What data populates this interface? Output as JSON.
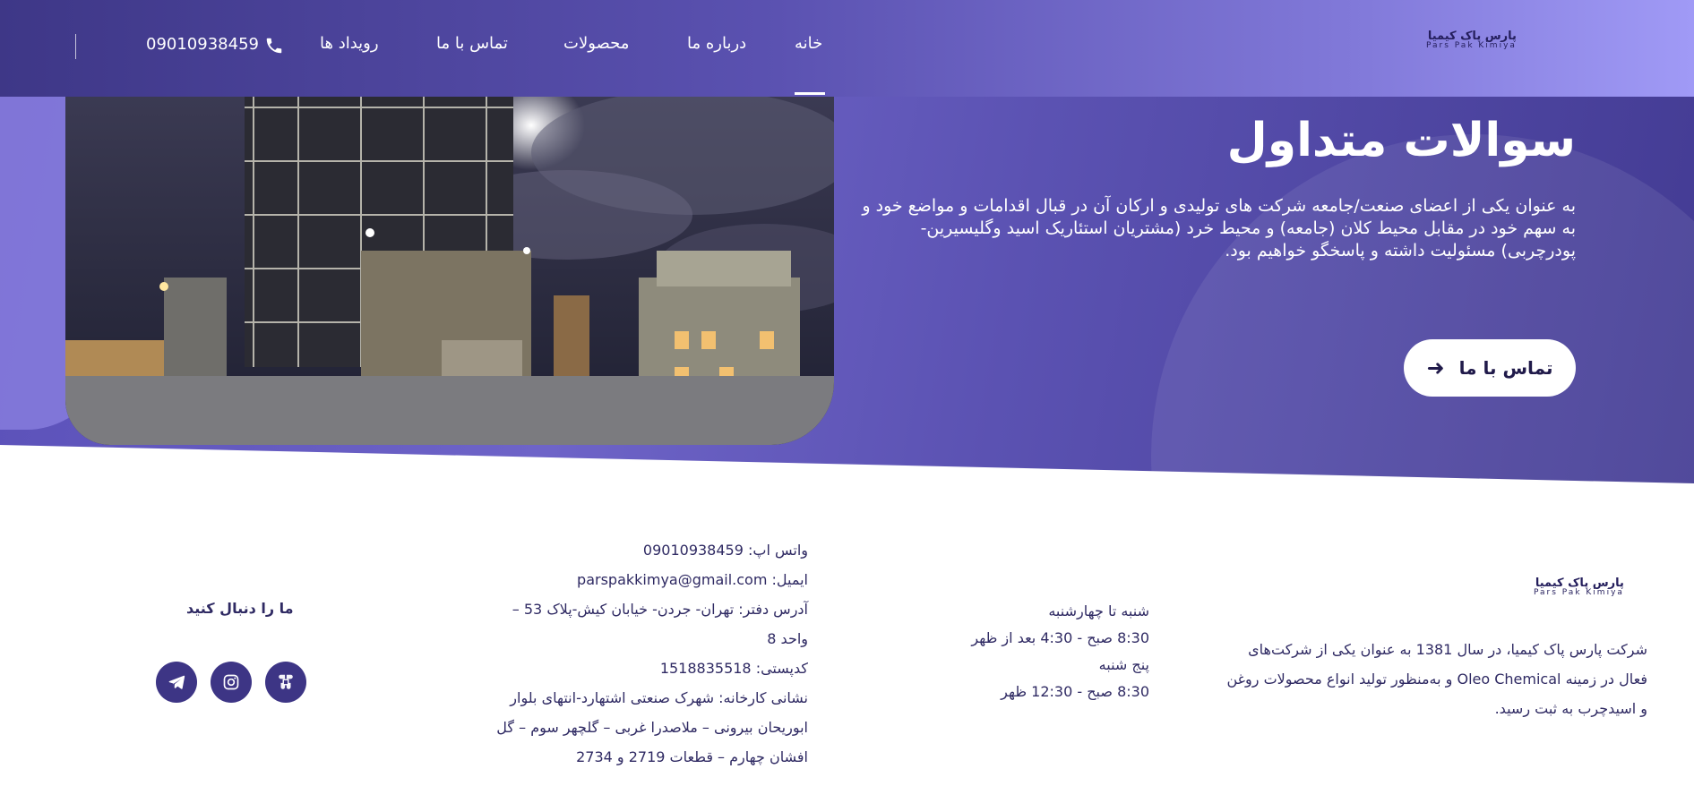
{
  "header": {
    "nav": [
      "خانه",
      "درباره ما",
      "محصولات",
      "تماس با ما",
      "رویداد ها"
    ],
    "phone": "09010938459",
    "active_color": "#ffffff"
  },
  "logo": {
    "fa": "پارس پاک کیمیا",
    "en": "Pars Pak Kimiya"
  },
  "hero": {
    "title": "سوالات متداول",
    "description": "به عنوان یکی از اعضای صنعت/جامعه شرکت های تولیدی و ارکان آن در قبال اقدامات و مواضع خود و به سهم خود در مقابل محیط کلان (جامعه) و محیط خرد (مشتریان استئاریک اسید وگلیسیرین-پودرچربی) مسئولیت داشته و پاسخگو خواهیم بود.",
    "button": "تماس با ما"
  },
  "footer": {
    "about": "شرکت پارس پاک کیمیا، در سال 1381 به عنوان یکی از شرکت‌های فعال در زمینه Oleo Chemical و به‌منظور تولید انواع محصولات روغن و اسیدچرب به ثبت رسید.",
    "hours": [
      "شنبه تا چهارشنبه",
      "8:30 صبح - 4:30 بعد از ظهر",
      "پنج شنبه",
      "8:30 صبح - 12:30 ظهر"
    ],
    "contact": {
      "whatsapp": "واتس اپ: 09010938459",
      "email": "ایمیل: parspakkimya@gmail.com",
      "office": "آدرس دفتر: تهران- جردن- خیابان کیش-پلاک 53 – واحد 8",
      "postal": "کدپستی: 1518835518",
      "factory": "نشانی کارخانه: شهرک صنعتی اشتهارد-انتهای بلوار ابوریحان بیرونی – ملاصدرا غربی – گلچهر سوم – گل افشان چهارم – قطعات 2719 و 2734"
    },
    "follow": "ما را دنبال کنید",
    "social": [
      "telegram-icon",
      "instagram-icon",
      "app-icon"
    ]
  },
  "colors": {
    "primary": "#3d3585",
    "text": "#2f2a63"
  }
}
